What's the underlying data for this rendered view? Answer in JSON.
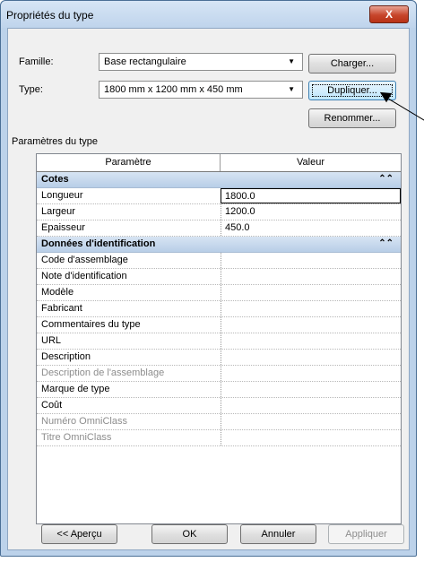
{
  "window": {
    "title": "Propriétés du type",
    "close_label": "X"
  },
  "family": {
    "label": "Famille:",
    "value": "Base rectangulaire"
  },
  "type": {
    "label": "Type:",
    "value": "1800 mm x 1200 mm x 450 mm"
  },
  "buttons": {
    "load": "Charger...",
    "duplicate": "Dupliquer...",
    "rename": "Renommer...",
    "preview": "<< Aperçu",
    "ok": "OK",
    "cancel": "Annuler",
    "apply": "Appliquer"
  },
  "type_params": {
    "section_label": "Paramètres du type",
    "col_param": "Paramètre",
    "col_value": "Valeur",
    "groups": [
      {
        "name": "Cotes",
        "rows": [
          {
            "name": "Longueur",
            "value": "1800.0"
          },
          {
            "name": "Largeur",
            "value": "1200.0"
          },
          {
            "name": "Epaisseur",
            "value": "450.0"
          }
        ]
      },
      {
        "name": "Données d'identification",
        "rows": [
          {
            "name": "Code d'assemblage",
            "value": ""
          },
          {
            "name": "Note d'identification",
            "value": ""
          },
          {
            "name": "Modèle",
            "value": ""
          },
          {
            "name": "Fabricant",
            "value": ""
          },
          {
            "name": "Commentaires du type",
            "value": ""
          },
          {
            "name": "URL",
            "value": ""
          },
          {
            "name": "Description",
            "value": ""
          },
          {
            "name": "Description de l'assemblage",
            "value": ""
          },
          {
            "name": "Marque de type",
            "value": ""
          },
          {
            "name": "Coût",
            "value": ""
          },
          {
            "name": "Numéro OmniClass",
            "value": ""
          },
          {
            "name": "Titre OmniClass",
            "value": ""
          }
        ]
      }
    ]
  },
  "icons": {
    "dropdown": "▼",
    "collapse": "⌃⌃"
  }
}
